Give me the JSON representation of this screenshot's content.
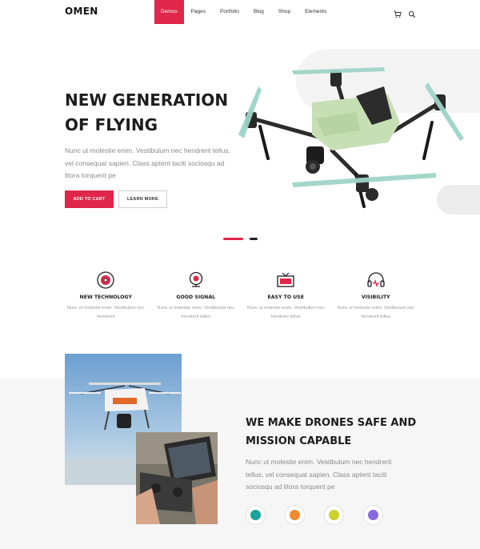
{
  "nav": {
    "logo": "OMEN",
    "items": [
      {
        "label": "Demos",
        "active": true
      },
      {
        "label": "Pages"
      },
      {
        "label": "Portfolio"
      },
      {
        "label": "Blog"
      },
      {
        "label": "Shop"
      },
      {
        "label": "Elements"
      }
    ],
    "icons": [
      "cart-icon",
      "search-icon"
    ]
  },
  "hero": {
    "title_line1": "NEW GENERATION",
    "title_line2": "OF FLYING",
    "text": "Nunc ut molestie enim. Vestibulum nec hendrerit tellus, vel consequat sapien. Class aptent taciti sociosqu ad litora torquent pe",
    "primary_button": "ADD TO CART",
    "secondary_button": "LEARN MORE",
    "slides": 2,
    "active_slide": 1
  },
  "features": [
    {
      "icon": "vinyl-record-icon",
      "title": "NEW TECHNOLOGY",
      "text": "Nunc ut molestie enim. Vestibulum nec hendrerit"
    },
    {
      "icon": "webcam-icon",
      "title": "GOOD SIGNAL",
      "text": "Nunc ut molestie enim. Vestibulum nec hendrerit tellus"
    },
    {
      "icon": "tv-icon",
      "title": "EASY TO USE",
      "text": "Nunc ut molestie enim. Vestibulum nec hendrerit tellus"
    },
    {
      "icon": "headphones-icon",
      "title": "VISIBILITY",
      "text": "Nunc ut molestie enim. Vestibulum nec hendrerit tellus"
    }
  ],
  "section": {
    "title_line1": "WE MAKE DRONES SAFE AND",
    "title_line2": "MISSION CAPABLE",
    "text": "Nunc ut molestie enim. Vestibulum nec hendrerit tellus, vel consequat sapien. Class aptent taciti sociosqu ad litora torquent pe",
    "color_swatches": [
      "#1aa39a",
      "#ef8a2c",
      "#cdd22a",
      "#8b67dc"
    ]
  },
  "colors": {
    "accent": "#e0264a",
    "text_dark": "#1d1d1d",
    "text_muted": "#8a8a8a"
  }
}
